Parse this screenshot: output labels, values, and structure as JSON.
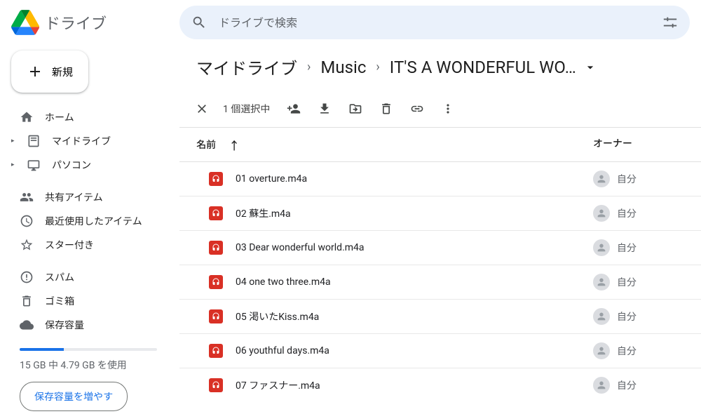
{
  "header": {
    "app_name": "ドライブ",
    "search_placeholder": "ドライブで検索"
  },
  "sidebar": {
    "new_label": "新規",
    "nav1": [
      {
        "label": "ホーム",
        "icon": "home"
      },
      {
        "label": "マイドライブ",
        "icon": "mydrive",
        "expandable": true
      },
      {
        "label": "パソコン",
        "icon": "computers",
        "expandable": true
      }
    ],
    "nav2": [
      {
        "label": "共有アイテム",
        "icon": "shared"
      },
      {
        "label": "最近使用したアイテム",
        "icon": "recent"
      },
      {
        "label": "スター付き",
        "icon": "star"
      }
    ],
    "nav3": [
      {
        "label": "スパム",
        "icon": "spam"
      },
      {
        "label": "ゴミ箱",
        "icon": "trash"
      },
      {
        "label": "保存容量",
        "icon": "storage"
      }
    ],
    "storage_text": "15 GB 中 4.79 GB を使用",
    "storage_btn": "保存容量を増やす"
  },
  "breadcrumb": {
    "c1": "マイドライブ",
    "c2": "Music",
    "c3": "IT'S A WONDERFUL WO…"
  },
  "toolbar": {
    "selection_text": "1 個選択中"
  },
  "table": {
    "header_name": "名前",
    "header_owner": "オーナー",
    "owner_self": "自分",
    "rows": [
      {
        "name": "01 overture.m4a"
      },
      {
        "name": "02 蘇生.m4a"
      },
      {
        "name": "03 Dear wonderful world.m4a"
      },
      {
        "name": "04 one two three.m4a"
      },
      {
        "name": "05 渇いたKiss.m4a"
      },
      {
        "name": "06 youthful days.m4a"
      },
      {
        "name": "07 ファスナー.m4a"
      }
    ]
  }
}
